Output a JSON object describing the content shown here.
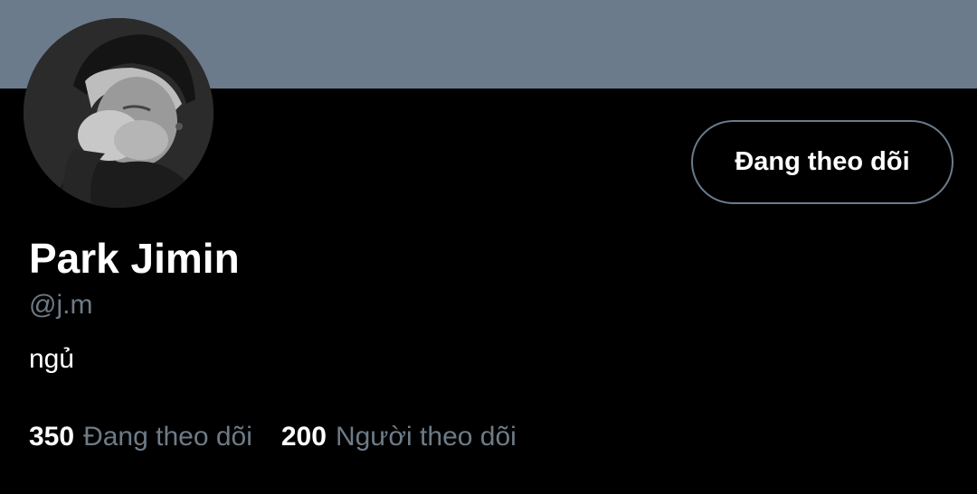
{
  "colors": {
    "banner": "#6b7b8b",
    "background": "#000000",
    "text_primary": "#ffffff",
    "text_secondary": "#6e7b87",
    "button_border": "#6b7b8b"
  },
  "profile": {
    "avatar_icon": "user-avatar-photo",
    "follow_button_label": "Đang theo dõi",
    "display_name": "Park Jimin",
    "handle": "@j.m",
    "bio": "ngủ"
  },
  "stats": {
    "following_count": "350",
    "following_label": "Đang theo dõi",
    "followers_count": "200",
    "followers_label": "Người theo dõi"
  }
}
